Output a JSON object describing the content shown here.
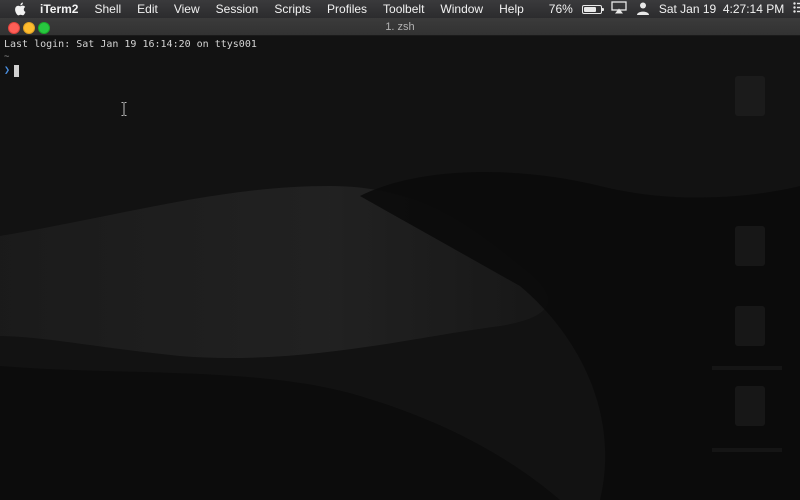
{
  "menubar": {
    "app_name": "iTerm2",
    "items": [
      "Shell",
      "Edit",
      "View",
      "Session",
      "Scripts",
      "Profiles",
      "Toolbelt",
      "Window",
      "Help"
    ],
    "battery_percent": "76%",
    "battery_level": 0.76,
    "datetime": "Sat Jan 19  4:27:14 PM"
  },
  "window": {
    "title": "1. zsh"
  },
  "terminal": {
    "last_login": "Last login: Sat Jan 19 16:14:20 on ttys001",
    "path": "~",
    "prompt_symbol": "❯"
  },
  "colors": {
    "close": "#fe5f57",
    "minimize": "#febc2e",
    "maximize": "#28c840",
    "prompt": "#4a90e2"
  }
}
